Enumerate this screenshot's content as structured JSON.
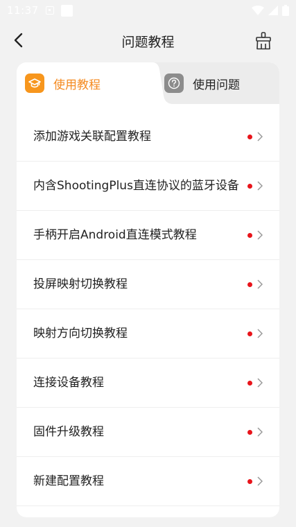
{
  "status_bar": {
    "time": "11:37"
  },
  "header": {
    "title": "问题教程"
  },
  "tabs": [
    {
      "label": "使用教程",
      "active": true,
      "icon": "graduation-cap-icon"
    },
    {
      "label": "使用问题",
      "active": false,
      "icon": "question-icon"
    }
  ],
  "items": [
    {
      "label": "添加游戏关联配置教程"
    },
    {
      "label": "内含ShootingPlus直连协议的蓝牙设备"
    },
    {
      "label": "手柄开启Android直连模式教程"
    },
    {
      "label": "投屏映射切换教程"
    },
    {
      "label": "映射方向切换教程"
    },
    {
      "label": "连接设备教程"
    },
    {
      "label": "固件升级教程"
    },
    {
      "label": "新建配置教程"
    }
  ],
  "colors": {
    "accent": "#f58a1f",
    "dot": "#e8141b",
    "background": "#f2f2f2"
  }
}
